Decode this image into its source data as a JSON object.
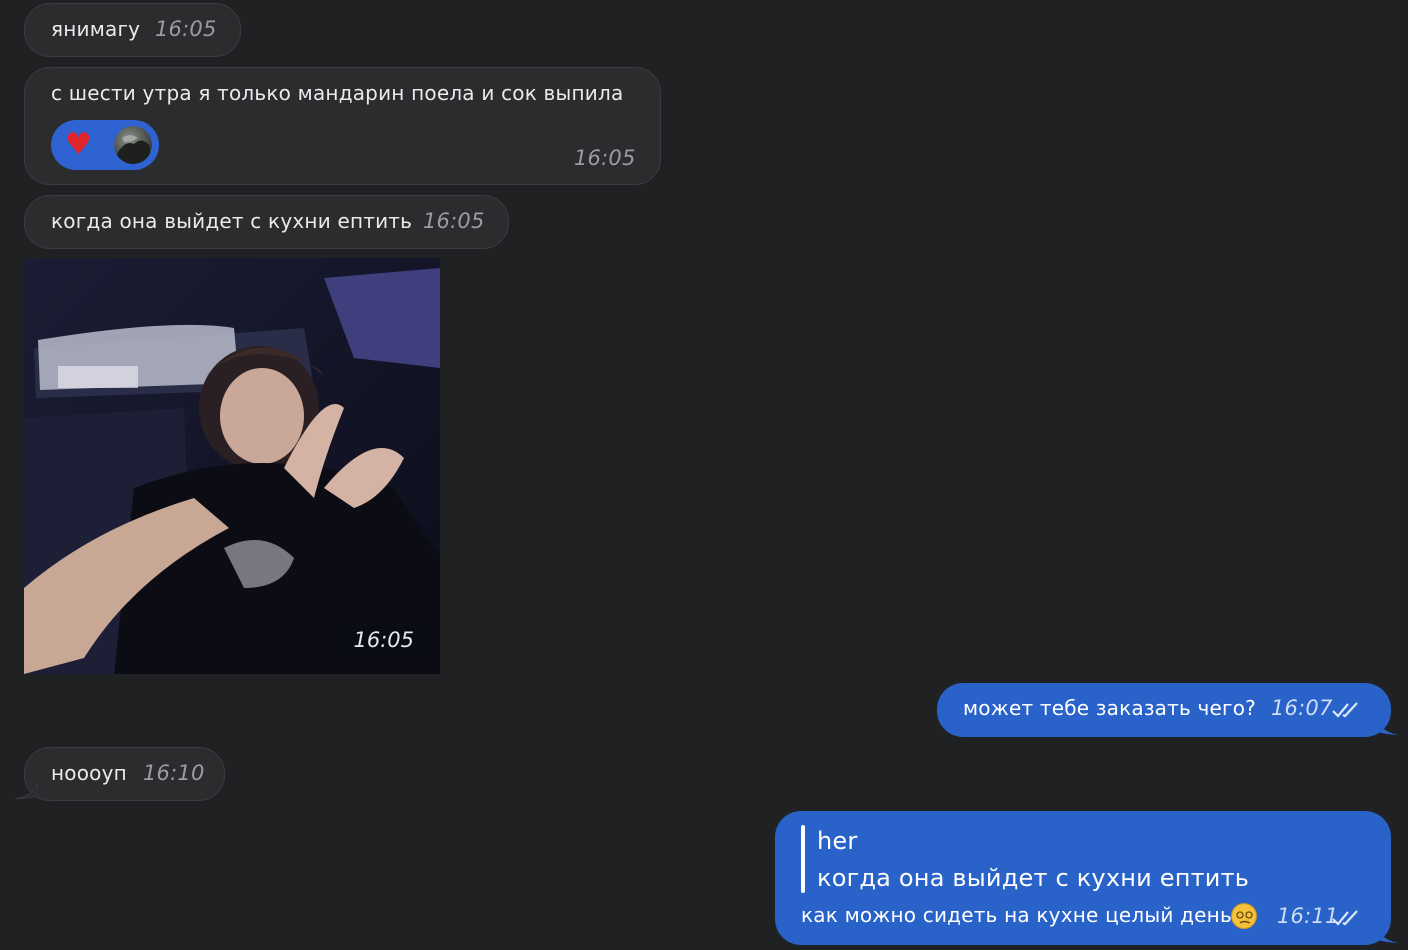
{
  "messages": {
    "m1": {
      "text": "янимагу",
      "time": "16:05"
    },
    "m2": {
      "text": "с шести утра я только мандарин поела и сок выпила",
      "time": "16:05",
      "reaction": {
        "icon": "heart-icon",
        "glyph": "♥"
      }
    },
    "m3": {
      "text": "когда она выйдет с кухни ептить",
      "time": "16:05"
    },
    "m4": {
      "media": "gif-person-in-car",
      "time": "16:05"
    },
    "m5": {
      "text": "может тебе заказать чего?",
      "time": "16:07"
    },
    "m6": {
      "text": "ноооуп",
      "time": "16:10"
    },
    "m7": {
      "reply_author": "her",
      "reply_text": "когда она выйдет с кухни ептить",
      "text": "как можно сидеть на кухне целый день",
      "time": "16:11"
    }
  },
  "colors": {
    "background": "#1f2123",
    "incoming_bubble": "#2b2c2e",
    "outgoing_bubble": "#2962c9",
    "reaction_pill": "#2f63d2",
    "heart": "#e0242b"
  }
}
